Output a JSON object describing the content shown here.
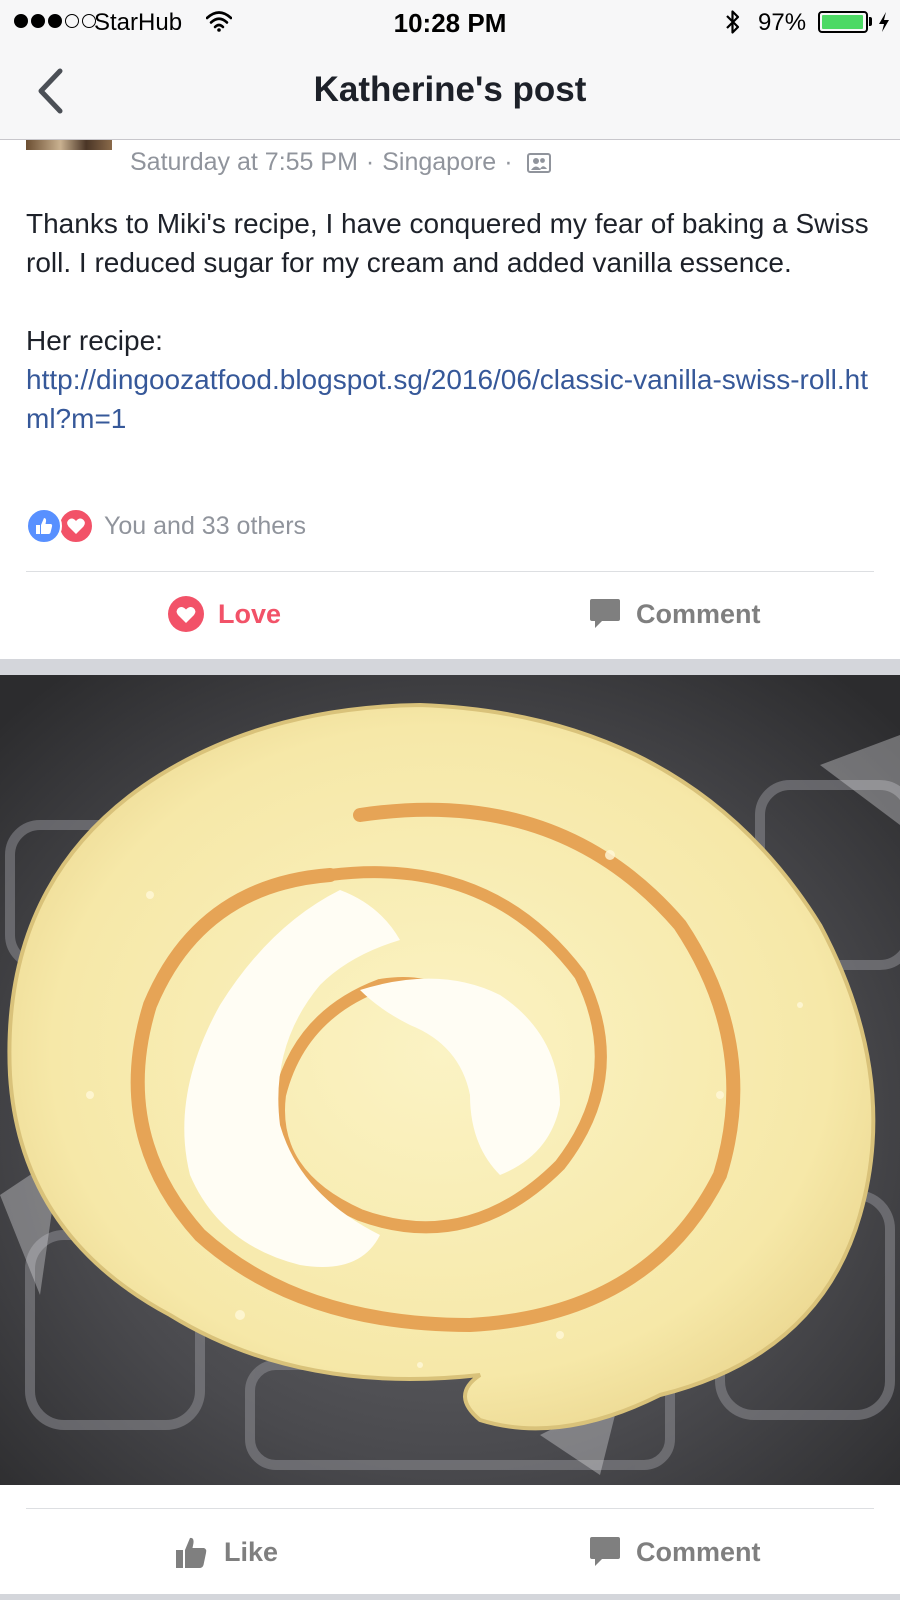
{
  "status_bar": {
    "carrier": "StarHub",
    "time": "10:28 PM",
    "battery_percent": "97%",
    "signal_bars_filled": 3,
    "signal_bars_total": 5,
    "battery_level": 0.97,
    "battery_color": "#4cd964"
  },
  "nav": {
    "title": "Katherine's post",
    "back_icon": "chevron-left-icon"
  },
  "post": {
    "timestamp": "Saturday at 7:55 PM",
    "meta_separator": "·",
    "location": "Singapore",
    "audience_icon": "friends-icon",
    "text_paragraph": "Thanks to Miki's recipe, I have conquered my fear of baking a Swiss roll. I reduced sugar for my cream and added vanilla essence.",
    "recipe_label": "Her recipe:",
    "recipe_link": "http://dingoozatfood.blogspot.sg/2016/06/classic-vanilla-swiss-roll.html?m=1",
    "reactions_text": "You and 33 others",
    "link_color": "#365899"
  },
  "actions": {
    "love_label": "Love",
    "comment_label": "Comment",
    "love_color": "#f25268"
  },
  "photo_actions": {
    "like_label": "Like",
    "comment_label": "Comment"
  }
}
